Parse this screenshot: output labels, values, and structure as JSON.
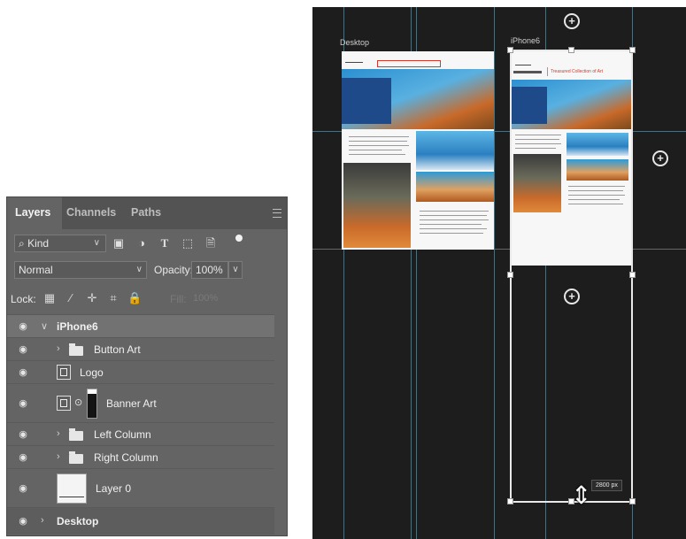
{
  "layers_panel": {
    "tabs": [
      "Layers",
      "Channels",
      "Paths"
    ],
    "kind_filter": "Kind",
    "blend_mode": "Normal",
    "opacity_label": "Opacity:",
    "opacity_value": "100%",
    "lock_label": "Lock:",
    "fill_label": "Fill:",
    "fill_value": "100%",
    "filter_icons": [
      "pixel-filter-icon",
      "adjustment-filter-icon",
      "type-filter-icon",
      "shape-filter-icon",
      "smart-object-filter-icon"
    ],
    "lock_icons": [
      "lock-transparent-icon",
      "lock-pixels-icon",
      "lock-position-icon",
      "lock-artboard-icon",
      "lock-all-icon"
    ],
    "layers": [
      {
        "name": "iPhone6",
        "kind": "artboard",
        "selected": true,
        "expanded": true
      },
      {
        "name": "Button Art",
        "kind": "group"
      },
      {
        "name": "Logo",
        "kind": "smart-object"
      },
      {
        "name": "Banner Art",
        "kind": "smart-object-with-mask"
      },
      {
        "name": "Left Column",
        "kind": "group"
      },
      {
        "name": "Right Column",
        "kind": "group"
      },
      {
        "name": "Layer 0",
        "kind": "pixel"
      },
      {
        "name": "Desktop",
        "kind": "artboard",
        "expanded": false
      }
    ]
  },
  "canvas": {
    "artboards": [
      {
        "label": "Desktop"
      },
      {
        "label": "iPhone6"
      }
    ],
    "banner_text": "Treasured Collection of Art",
    "size_tooltip": "2800 px",
    "colors": {
      "canvas_bg": "#1d1d1d",
      "guide": "#4f6e78",
      "banner_red": "#d03a2b",
      "sky_blue": "#2b8fd0",
      "wood_orange": "#c96a2a"
    }
  }
}
